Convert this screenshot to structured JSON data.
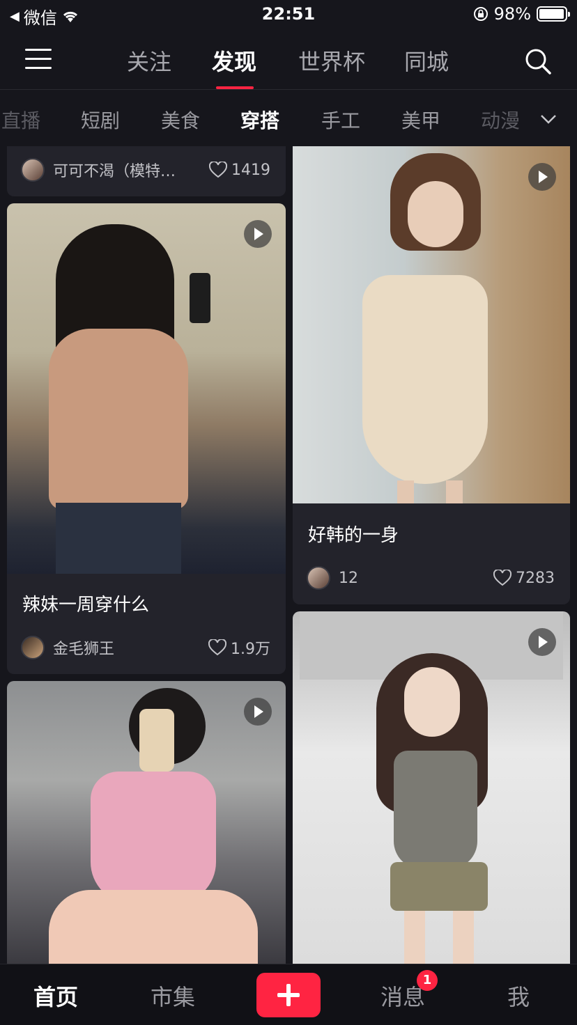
{
  "status_bar": {
    "carrier": "微信",
    "time": "22:51",
    "battery": "98%",
    "battery_level": 0.98
  },
  "top_tabs": [
    {
      "label": "关注",
      "active": false
    },
    {
      "label": "发现",
      "active": true
    },
    {
      "label": "世界杯",
      "active": false
    },
    {
      "label": "同城",
      "active": false
    }
  ],
  "categories": [
    {
      "label": "直播"
    },
    {
      "label": "短剧"
    },
    {
      "label": "美食"
    },
    {
      "label": "穿搭",
      "active": true
    },
    {
      "label": "手工"
    },
    {
      "label": "美甲"
    },
    {
      "label": "动漫"
    }
  ],
  "feed": {
    "card_partial": {
      "author": "可可不渴（模特…",
      "likes": "1419"
    },
    "card_left_1": {
      "title": "辣妹一周穿什么",
      "author": "金毛狮王",
      "likes": "1.9万",
      "has_video": true
    },
    "card_right_1": {
      "title": "好韩的一身",
      "author": "12",
      "likes": "7283",
      "has_video": true
    },
    "card_left_2": {
      "has_video": true
    },
    "card_right_2": {
      "has_video": true
    }
  },
  "bottom_nav": {
    "home": "首页",
    "market": "市集",
    "messages": "消息",
    "messages_badge": "1",
    "me": "我"
  },
  "colors": {
    "accent": "#ff2442",
    "background": "#16161c",
    "card": "#23232b"
  }
}
